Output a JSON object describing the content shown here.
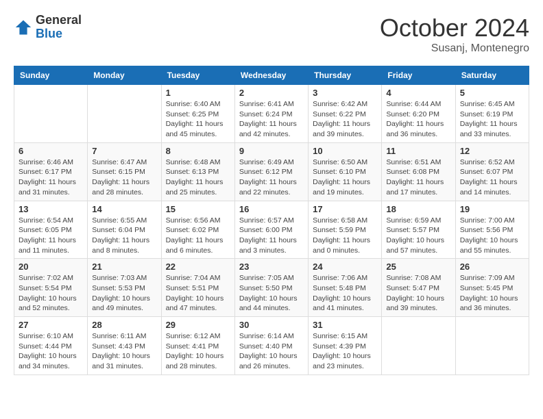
{
  "logo": {
    "general": "General",
    "blue": "Blue"
  },
  "title": "October 2024",
  "subtitle": "Susanj, Montenegro",
  "days_of_week": [
    "Sunday",
    "Monday",
    "Tuesday",
    "Wednesday",
    "Thursday",
    "Friday",
    "Saturday"
  ],
  "weeks": [
    [
      {
        "day": "",
        "info": ""
      },
      {
        "day": "",
        "info": ""
      },
      {
        "day": "1",
        "info": "Sunrise: 6:40 AM\nSunset: 6:25 PM\nDaylight: 11 hours and 45 minutes."
      },
      {
        "day": "2",
        "info": "Sunrise: 6:41 AM\nSunset: 6:24 PM\nDaylight: 11 hours and 42 minutes."
      },
      {
        "day": "3",
        "info": "Sunrise: 6:42 AM\nSunset: 6:22 PM\nDaylight: 11 hours and 39 minutes."
      },
      {
        "day": "4",
        "info": "Sunrise: 6:44 AM\nSunset: 6:20 PM\nDaylight: 11 hours and 36 minutes."
      },
      {
        "day": "5",
        "info": "Sunrise: 6:45 AM\nSunset: 6:19 PM\nDaylight: 11 hours and 33 minutes."
      }
    ],
    [
      {
        "day": "6",
        "info": "Sunrise: 6:46 AM\nSunset: 6:17 PM\nDaylight: 11 hours and 31 minutes."
      },
      {
        "day": "7",
        "info": "Sunrise: 6:47 AM\nSunset: 6:15 PM\nDaylight: 11 hours and 28 minutes."
      },
      {
        "day": "8",
        "info": "Sunrise: 6:48 AM\nSunset: 6:13 PM\nDaylight: 11 hours and 25 minutes."
      },
      {
        "day": "9",
        "info": "Sunrise: 6:49 AM\nSunset: 6:12 PM\nDaylight: 11 hours and 22 minutes."
      },
      {
        "day": "10",
        "info": "Sunrise: 6:50 AM\nSunset: 6:10 PM\nDaylight: 11 hours and 19 minutes."
      },
      {
        "day": "11",
        "info": "Sunrise: 6:51 AM\nSunset: 6:08 PM\nDaylight: 11 hours and 17 minutes."
      },
      {
        "day": "12",
        "info": "Sunrise: 6:52 AM\nSunset: 6:07 PM\nDaylight: 11 hours and 14 minutes."
      }
    ],
    [
      {
        "day": "13",
        "info": "Sunrise: 6:54 AM\nSunset: 6:05 PM\nDaylight: 11 hours and 11 minutes."
      },
      {
        "day": "14",
        "info": "Sunrise: 6:55 AM\nSunset: 6:04 PM\nDaylight: 11 hours and 8 minutes."
      },
      {
        "day": "15",
        "info": "Sunrise: 6:56 AM\nSunset: 6:02 PM\nDaylight: 11 hours and 6 minutes."
      },
      {
        "day": "16",
        "info": "Sunrise: 6:57 AM\nSunset: 6:00 PM\nDaylight: 11 hours and 3 minutes."
      },
      {
        "day": "17",
        "info": "Sunrise: 6:58 AM\nSunset: 5:59 PM\nDaylight: 11 hours and 0 minutes."
      },
      {
        "day": "18",
        "info": "Sunrise: 6:59 AM\nSunset: 5:57 PM\nDaylight: 10 hours and 57 minutes."
      },
      {
        "day": "19",
        "info": "Sunrise: 7:00 AM\nSunset: 5:56 PM\nDaylight: 10 hours and 55 minutes."
      }
    ],
    [
      {
        "day": "20",
        "info": "Sunrise: 7:02 AM\nSunset: 5:54 PM\nDaylight: 10 hours and 52 minutes."
      },
      {
        "day": "21",
        "info": "Sunrise: 7:03 AM\nSunset: 5:53 PM\nDaylight: 10 hours and 49 minutes."
      },
      {
        "day": "22",
        "info": "Sunrise: 7:04 AM\nSunset: 5:51 PM\nDaylight: 10 hours and 47 minutes."
      },
      {
        "day": "23",
        "info": "Sunrise: 7:05 AM\nSunset: 5:50 PM\nDaylight: 10 hours and 44 minutes."
      },
      {
        "day": "24",
        "info": "Sunrise: 7:06 AM\nSunset: 5:48 PM\nDaylight: 10 hours and 41 minutes."
      },
      {
        "day": "25",
        "info": "Sunrise: 7:08 AM\nSunset: 5:47 PM\nDaylight: 10 hours and 39 minutes."
      },
      {
        "day": "26",
        "info": "Sunrise: 7:09 AM\nSunset: 5:45 PM\nDaylight: 10 hours and 36 minutes."
      }
    ],
    [
      {
        "day": "27",
        "info": "Sunrise: 6:10 AM\nSunset: 4:44 PM\nDaylight: 10 hours and 34 minutes."
      },
      {
        "day": "28",
        "info": "Sunrise: 6:11 AM\nSunset: 4:43 PM\nDaylight: 10 hours and 31 minutes."
      },
      {
        "day": "29",
        "info": "Sunrise: 6:12 AM\nSunset: 4:41 PM\nDaylight: 10 hours and 28 minutes."
      },
      {
        "day": "30",
        "info": "Sunrise: 6:14 AM\nSunset: 4:40 PM\nDaylight: 10 hours and 26 minutes."
      },
      {
        "day": "31",
        "info": "Sunrise: 6:15 AM\nSunset: 4:39 PM\nDaylight: 10 hours and 23 minutes."
      },
      {
        "day": "",
        "info": ""
      },
      {
        "day": "",
        "info": ""
      }
    ]
  ]
}
